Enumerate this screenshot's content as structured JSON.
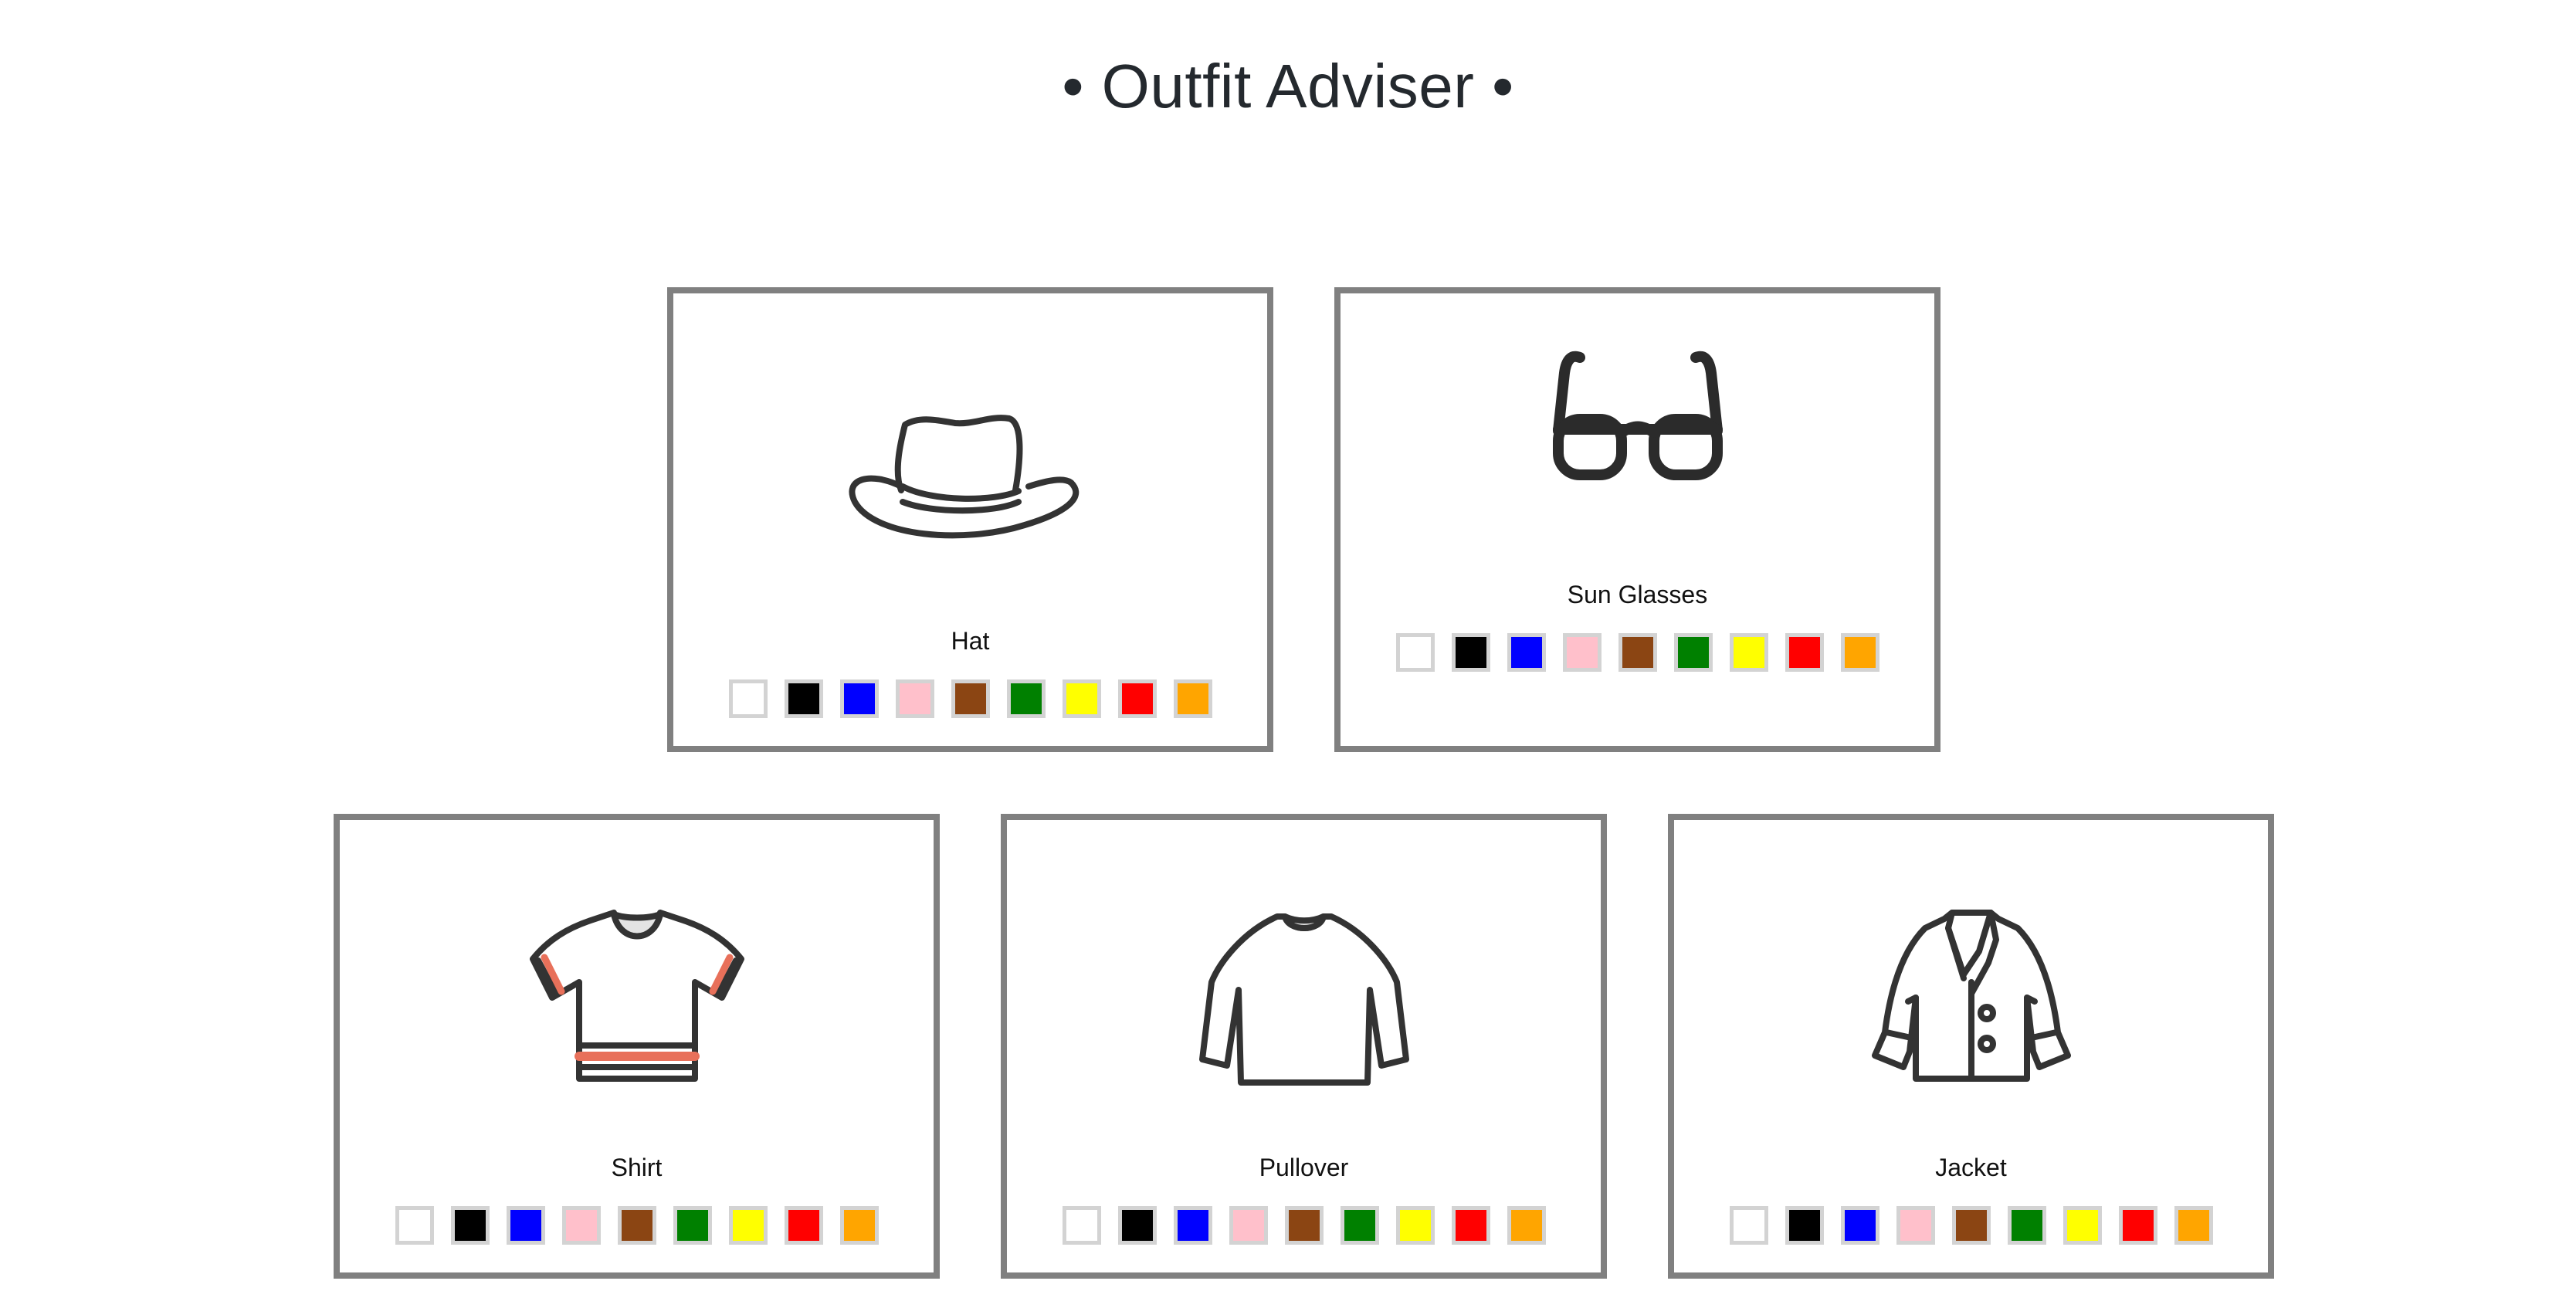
{
  "header": {
    "title": "• Outfit Adviser •"
  },
  "palette": [
    {
      "name": "white",
      "color": "#ffffff"
    },
    {
      "name": "black",
      "color": "#000000"
    },
    {
      "name": "blue",
      "color": "#0000ff"
    },
    {
      "name": "pink",
      "color": "#ffc0cb"
    },
    {
      "name": "brown",
      "color": "#8b4513"
    },
    {
      "name": "green",
      "color": "#008000"
    },
    {
      "name": "yellow",
      "color": "#ffff00"
    },
    {
      "name": "red",
      "color": "#ff0000"
    },
    {
      "name": "orange",
      "color": "#ffa500"
    }
  ],
  "items": [
    {
      "id": "hat",
      "label": "Hat",
      "icon": "hat-icon"
    },
    {
      "id": "sunglasses",
      "label": "Sun Glasses",
      "icon": "sunglasses-icon"
    },
    {
      "id": "shirt",
      "label": "Shirt",
      "icon": "shirt-icon"
    },
    {
      "id": "pullover",
      "label": "Pullover",
      "icon": "pullover-icon"
    },
    {
      "id": "jacket",
      "label": "Jacket",
      "icon": "jacket-icon"
    }
  ]
}
